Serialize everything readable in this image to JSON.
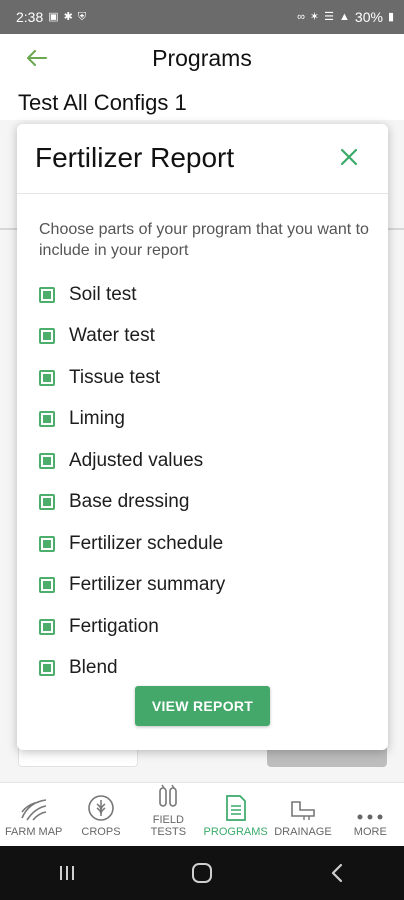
{
  "status_bar": {
    "time": "2:38",
    "battery": "30%"
  },
  "header": {
    "title": "Programs",
    "back_icon": "arrow-left-icon"
  },
  "page": {
    "program_name": "Test All Configs 1"
  },
  "modal": {
    "title": "Fertilizer Report",
    "close_icon": "close-icon",
    "instructions": "Choose parts of your program that you want to include in your report",
    "options": [
      {
        "label": "Soil test",
        "checked": true
      },
      {
        "label": "Water test",
        "checked": true
      },
      {
        "label": "Tissue test",
        "checked": true
      },
      {
        "label": "Liming",
        "checked": true
      },
      {
        "label": "Adjusted values",
        "checked": true
      },
      {
        "label": "Base dressing",
        "checked": true
      },
      {
        "label": "Fertilizer schedule",
        "checked": true
      },
      {
        "label": "Fertilizer summary",
        "checked": true
      },
      {
        "label": "Fertigation",
        "checked": true
      },
      {
        "label": "Blend",
        "checked": true
      }
    ],
    "view_report_label": "VIEW REPORT"
  },
  "bottom_nav": {
    "items": [
      {
        "label": "FARM MAP",
        "icon": "farm-map-icon",
        "active": false
      },
      {
        "label": "CROPS",
        "icon": "crops-icon",
        "active": false
      },
      {
        "label": "FIELD\nTESTS",
        "icon": "field-tests-icon",
        "active": false
      },
      {
        "label": "PROGRAMS",
        "icon": "programs-icon",
        "active": true
      },
      {
        "label": "DRAINAGE",
        "icon": "drainage-icon",
        "active": false
      },
      {
        "label": "MORE",
        "icon": "more-icon",
        "active": false
      }
    ]
  },
  "colors": {
    "accent": "#43a86a",
    "status_bar": "#6b6b6b",
    "android_nav": "#111111"
  }
}
